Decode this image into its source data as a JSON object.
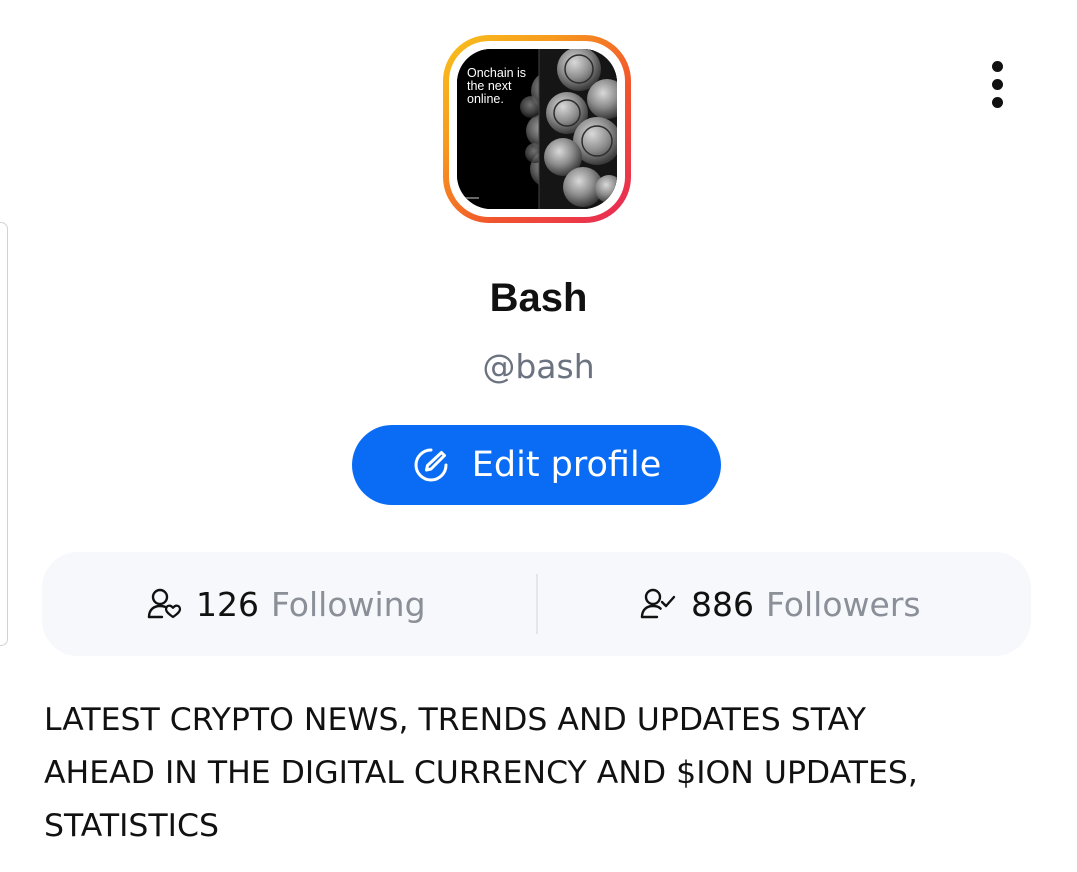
{
  "profile": {
    "avatar_caption": "Onchain is\nthe next\nonline.",
    "display_name": "Bash",
    "handle": "@bash",
    "edit_label": "Edit profile",
    "bio": "LATEST CRYPTO NEWS, TRENDS AND UPDATES STAY\nAHEAD IN THE DIGITAL CURRENCY AND $ION UPDATES,\nSTATISTICS"
  },
  "stats": {
    "following_count": "126",
    "following_label": "Following",
    "followers_count": "886",
    "followers_label": "Followers"
  },
  "icons": {
    "more": "more-vertical-icon",
    "edit": "edit-pencil-circle-icon",
    "following": "user-heart-icon",
    "followers": "user-check-icon"
  },
  "colors": {
    "accent": "#0a6cf5",
    "avatar_ring_start": "#f8c21c",
    "avatar_ring_end": "#e8265a",
    "muted_text": "#8a8f98",
    "handle_text": "#6b7280",
    "stats_bg": "#f6f8fb"
  }
}
